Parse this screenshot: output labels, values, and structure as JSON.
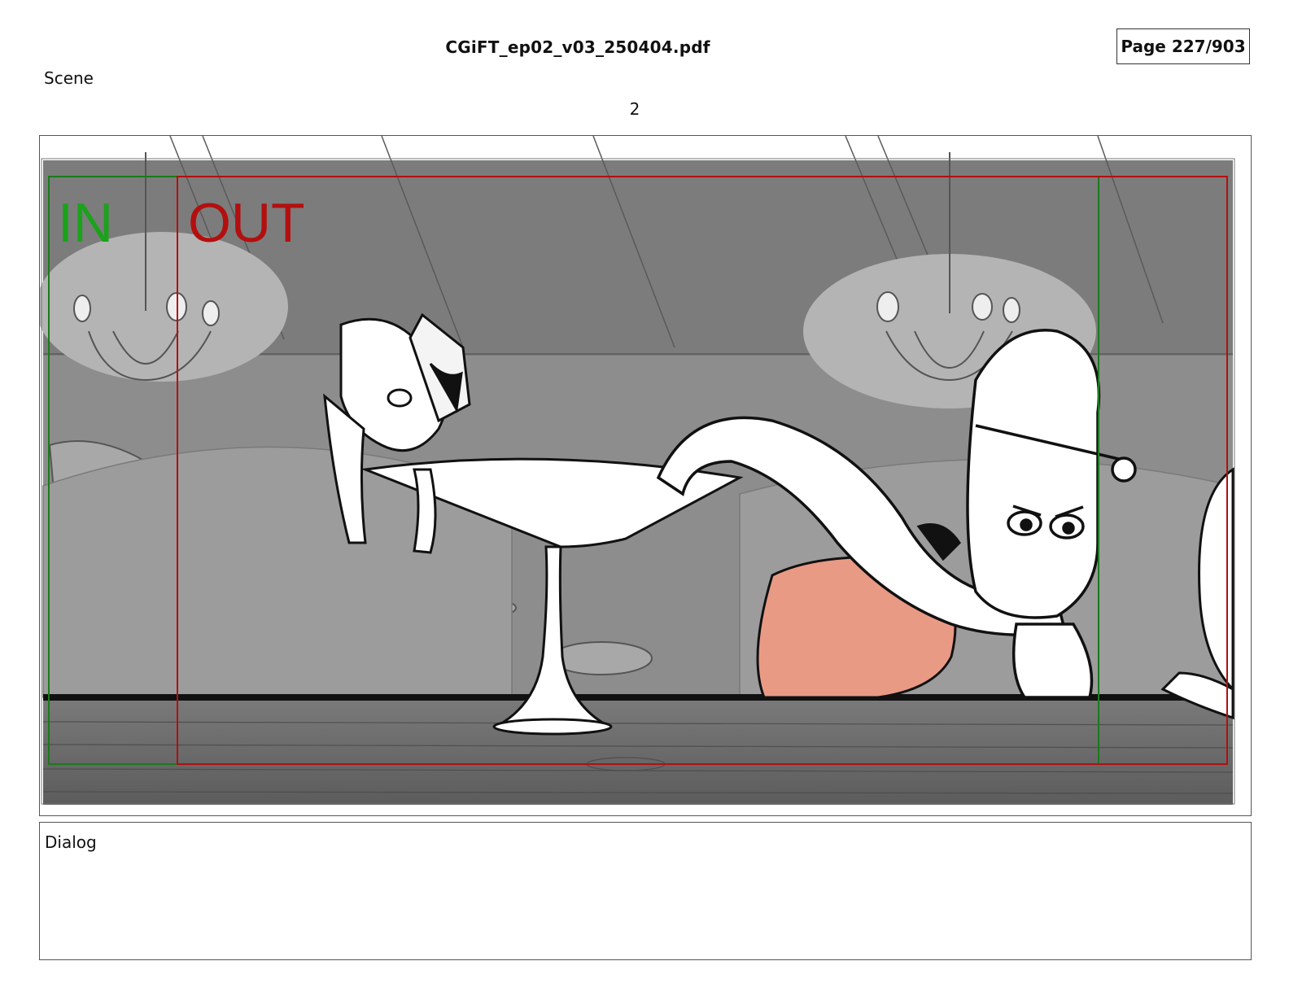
{
  "document": {
    "filename": "CGiFT_ep02_v03_250404.pdf",
    "page_indicator": "Page 227/903"
  },
  "scene": {
    "label": "Scene",
    "number": "2"
  },
  "panel": {
    "in_marker": "IN",
    "out_marker": "OUT",
    "in_color": "#1aa31a",
    "out_color": "#b30f0f",
    "background_gray": "#8c8c8c",
    "character_skin": "#e99a85"
  },
  "dialog": {
    "label": "Dialog",
    "text": ""
  }
}
